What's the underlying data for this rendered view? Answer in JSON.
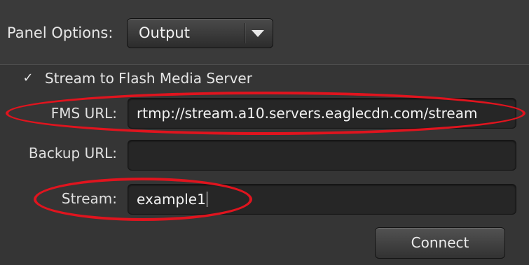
{
  "panel_options": {
    "label": "Panel Options:",
    "selected": "Output"
  },
  "stream_checkbox": {
    "label": "Stream to Flash Media Server",
    "checked": true,
    "mark": "✓"
  },
  "fields": {
    "fms_url": {
      "label": "FMS URL:",
      "value": "rtmp://stream.a10.servers.eaglecdn.com/stream"
    },
    "backup_url": {
      "label": "Backup URL:",
      "value": ""
    },
    "stream": {
      "label": "Stream:",
      "value": "example1"
    }
  },
  "connect_label": "Connect",
  "annotation_color": "#e0141e"
}
